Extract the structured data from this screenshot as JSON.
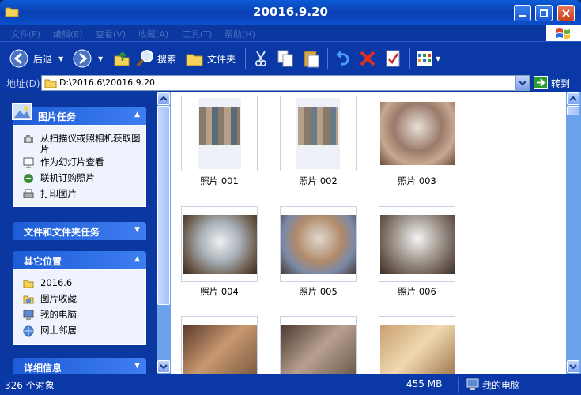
{
  "window": {
    "title": "20016.9.20"
  },
  "menu": [
    "文件(F)",
    "编辑(E)",
    "查看(V)",
    "收藏(A)",
    "工具(T)",
    "帮助(H)"
  ],
  "toolbar": {
    "back_label": "后退",
    "search_label": "搜索",
    "folders_label": "文件夹"
  },
  "address": {
    "label": "地址(D)",
    "value": "D:\\2016.6\\20016.9.20",
    "go_label": "转到"
  },
  "left": {
    "picture_tasks": {
      "title": "图片任务",
      "items": [
        "从扫描仪或照相机获取图片",
        "作为幻灯片查看",
        "联机订购照片",
        "打印图片"
      ]
    },
    "file_tasks": {
      "title": "文件和文件夹任务"
    },
    "other_places": {
      "title": "其它位置",
      "items": [
        "2016.6",
        "图片收藏",
        "我的电脑",
        "网上邻居"
      ]
    },
    "details": {
      "title": "详细信息"
    }
  },
  "files": [
    "照片 001",
    "照片 002",
    "照片 003",
    "照片 004",
    "照片 005",
    "照片 006"
  ],
  "status": {
    "count": "326 个对象",
    "size": "455 MB",
    "location": "我的电脑"
  }
}
